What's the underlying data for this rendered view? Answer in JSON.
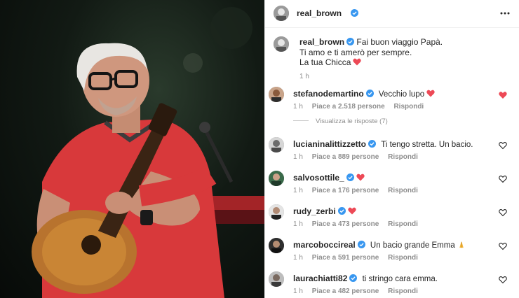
{
  "post": {
    "author": "real_brown",
    "caption_lines": [
      "Fai buon viaggio Papà.",
      "Ti amo e ti amerò per sempre.",
      "La tua Chicca"
    ],
    "caption_time": "1 h"
  },
  "icons": {
    "verified": "verified-badge-icon",
    "more": "more-options-icon",
    "like": "heart-outline-icon",
    "heart_emoji": "red-heart-emoji",
    "pray_emoji": "folded-hands-emoji"
  },
  "colors": {
    "verified": "#3897f0",
    "heart": "#ed4956",
    "muted": "#8e8e8e"
  },
  "comments": [
    {
      "user": "stefanodemartino",
      "text": "Vecchio lupo",
      "heart_emoji": true,
      "time": "1 h",
      "likes": "Piace a 2.518 persone",
      "reply": "Rispondi",
      "liked": true
    },
    {
      "user": "lucianinalittizzetto",
      "text": "Ti tengo stretta. Un bacio.",
      "time": "1 h",
      "likes": "Piace a 889 persone",
      "reply": "Rispondi",
      "liked": false
    },
    {
      "user": "salvosottile_",
      "text": "",
      "heart_emoji": true,
      "time": "1 h",
      "likes": "Piace a 176 persone",
      "reply": "Rispondi",
      "liked": false
    },
    {
      "user": "rudy_zerbi",
      "text": "",
      "heart_emoji": true,
      "time": "1 h",
      "likes": "Piace a 473 persone",
      "reply": "Rispondi",
      "liked": false
    },
    {
      "user": "marcoboccireal",
      "text": "Un bacio grande Emma",
      "pray_emoji": true,
      "time": "1 h",
      "likes": "Piace a 591 persone",
      "reply": "Rispondi",
      "liked": false
    },
    {
      "user": "laurachiatti82",
      "text": "ti stringo cara emma.",
      "time": "1 h",
      "likes": "Piace a 482 persone",
      "reply": "Rispondi",
      "liked": false
    }
  ],
  "view_replies": "Visualizza le risposte (7)"
}
